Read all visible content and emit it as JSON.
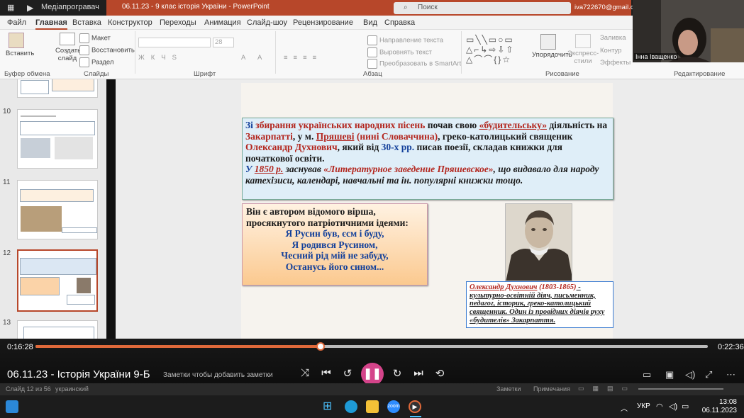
{
  "window": {
    "app_name": "Медіапрогравач",
    "file_title": "06.11.23 - 9 клас історія України - PowerPoint",
    "search_placeholder": "Поиск",
    "account": "iva722670@gmail.com"
  },
  "ribbon_tabs": [
    "Файл",
    "Главная",
    "Вставка",
    "Конструктор",
    "Переходы",
    "Анимация",
    "Слайд-шоу",
    "Рецензирование",
    "Вид",
    "Справка"
  ],
  "ribbon": {
    "paste": "Вставить",
    "create_slide": "Создать слайд",
    "layout": "Макет",
    "restore": "Восстановить",
    "section": "Раздел",
    "text_direction": "Направление текста",
    "align_text": "Выровнять текст",
    "smartart": "Преобразовать в SmartArt",
    "arrange": "Упорядочить",
    "quick_styles": "Экспресс-стили",
    "fill": "Заливка",
    "outline": "Контур",
    "effects": "Эффекты",
    "font_size": "28",
    "groups": {
      "clipboard": "Буфер обмена",
      "slides": "Слайды",
      "font": "Шрифт",
      "paragraph": "Абзац",
      "drawing": "Рисование",
      "editing": "Редактирование"
    }
  },
  "thumbnails": [
    {
      "num": "10"
    },
    {
      "num": "11"
    },
    {
      "num": "12"
    },
    {
      "num": "13"
    }
  ],
  "slide": {
    "box1": {
      "p1a": "Зі ",
      "p1b": "збирання українських народних пісень",
      "p1c": " почав свою ",
      "p1d": "«будительську»",
      "p1e": " діяльність на ",
      "p1f": "Закарпатті",
      "p1g": ", у м. ",
      "p1h": "Пряшеві",
      "p1i": " (нині Словаччина)",
      "p1j": ", греко-католицький священик",
      "p2a": "Олександр Духнович",
      "p2b": ", який від ",
      "p2c": "30-х рр.",
      "p2d": " писав поезії, складав книжки для початкової освіти.",
      "p3a": "У ",
      "p3b": "1850 р.",
      "p3c": " заснував ",
      "p3d": "«Литературное заведение Пряшевское»",
      "p3e": ", що видавало для народу катехізиси, календарі, навчальні та ін. популярні книжки тощо."
    },
    "box2": {
      "intro": "Він є автором відомого вірша, просякнутого патріотичними ідеями:",
      "verse": [
        "Я Русин був, єсм і буду,",
        "Я родився Русином,",
        "Чесний рід мій не забуду,",
        "Останусь його сином..."
      ]
    },
    "caption": {
      "name": "Олександр Духнович",
      "years": " (1803-1865)",
      "text": " - культурно-освітній діяч, письменник, педагог, історик, греко-католицький священник. Один із провідних діячів руху «будителів» Закарпаття."
    }
  },
  "webcam": {
    "name": "Інна Іващенко"
  },
  "player": {
    "elapsed": "0:16:28",
    "total": "0:22:36",
    "progress": 0.424,
    "title": "06.11.23 - Історія України 9-Б",
    "notes_hint": "Заметки чтобы добавить заметки"
  },
  "status": {
    "slide": "Слайд 12 из 56",
    "lang": "украинский",
    "notes": "Заметки",
    "comments": "Примечания"
  },
  "tray": {
    "lang": "УКР",
    "time": "13:08",
    "date": "06.11.2023"
  }
}
